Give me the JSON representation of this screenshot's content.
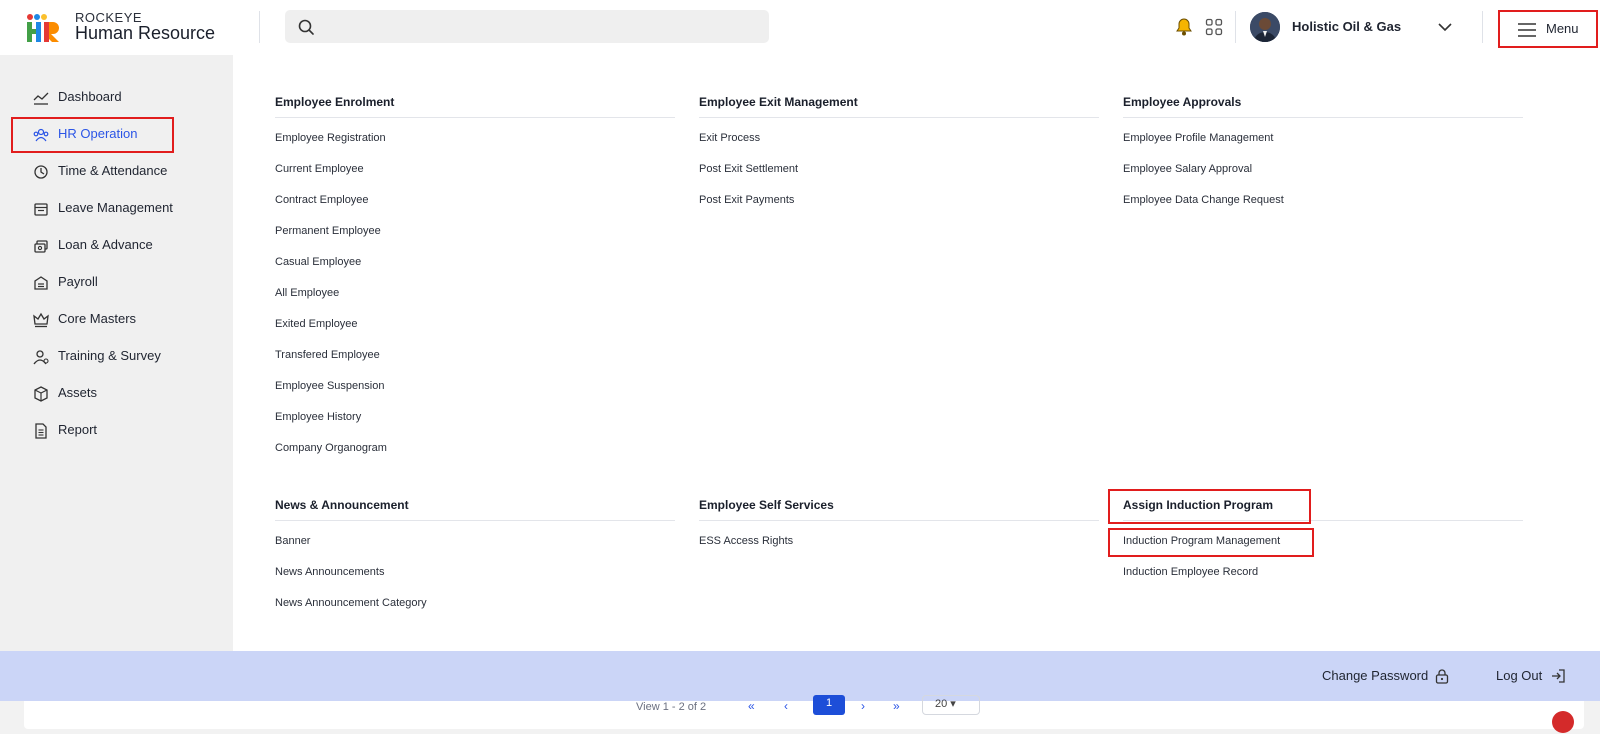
{
  "brand": {
    "top": "ROCKEYE",
    "bottom": "Human Resource"
  },
  "search": {
    "placeholder": ""
  },
  "header": {
    "company": "Holistic Oil & Gas",
    "menu_label": "Menu",
    "icons": [
      "notification-bell-icon",
      "apps-grid-icon",
      "chevron-down-icon",
      "hamburger-icon"
    ]
  },
  "sidebar": {
    "items": [
      {
        "label": "Dashboard",
        "icon": "dashboard-icon"
      },
      {
        "label": "HR Operation",
        "icon": "hr-operation-icon",
        "active": true
      },
      {
        "label": "Time & Attendance",
        "icon": "clock-history-icon"
      },
      {
        "label": "Leave Management",
        "icon": "calendar-icon"
      },
      {
        "label": "Loan & Advance",
        "icon": "money-icon"
      },
      {
        "label": "Payroll",
        "icon": "payroll-icon"
      },
      {
        "label": "Core Masters",
        "icon": "crown-icon"
      },
      {
        "label": "Training & Survey",
        "icon": "user-training-icon"
      },
      {
        "label": "Assets",
        "icon": "box-icon"
      },
      {
        "label": "Report",
        "icon": "document-icon"
      }
    ]
  },
  "sections": [
    {
      "title": "Employee Enrolment",
      "links": [
        "Employee Registration",
        "Current Employee",
        "Contract Employee",
        "Permanent Employee",
        "Casual Employee",
        "All Employee",
        "Exited Employee",
        "Transfered Employee",
        "Employee Suspension",
        "Employee History",
        "Company Organogram"
      ]
    },
    {
      "title": "Employee Exit Management",
      "links": [
        "Exit Process",
        "Post Exit Settlement",
        "Post Exit Payments"
      ]
    },
    {
      "title": "Employee Approvals",
      "links": [
        "Employee Profile Management",
        "Employee Salary Approval",
        "Employee Data Change Request"
      ]
    },
    {
      "title": "News & Announcement",
      "links": [
        "Banner",
        "News Announcements",
        "News Announcement Category"
      ]
    },
    {
      "title": "Employee Self Services",
      "links": [
        "ESS Access Rights"
      ]
    },
    {
      "title": "Assign Induction Program",
      "links": [
        "Induction Program Management",
        "Induction Employee Record"
      ]
    }
  ],
  "footer": {
    "change_password": "Change Password",
    "logout": "Log Out"
  },
  "pagination": {
    "view_text": "View 1 - 2 of 2",
    "first": "«",
    "prev": "‹",
    "current": "1",
    "next": "›",
    "last": "»",
    "page_size": "20"
  },
  "colors": {
    "accent": "#2b55e6",
    "highlight": "#e11d1d",
    "footer_bg": "#cbd5f7",
    "sidebar_bg": "#f0f0f0"
  }
}
